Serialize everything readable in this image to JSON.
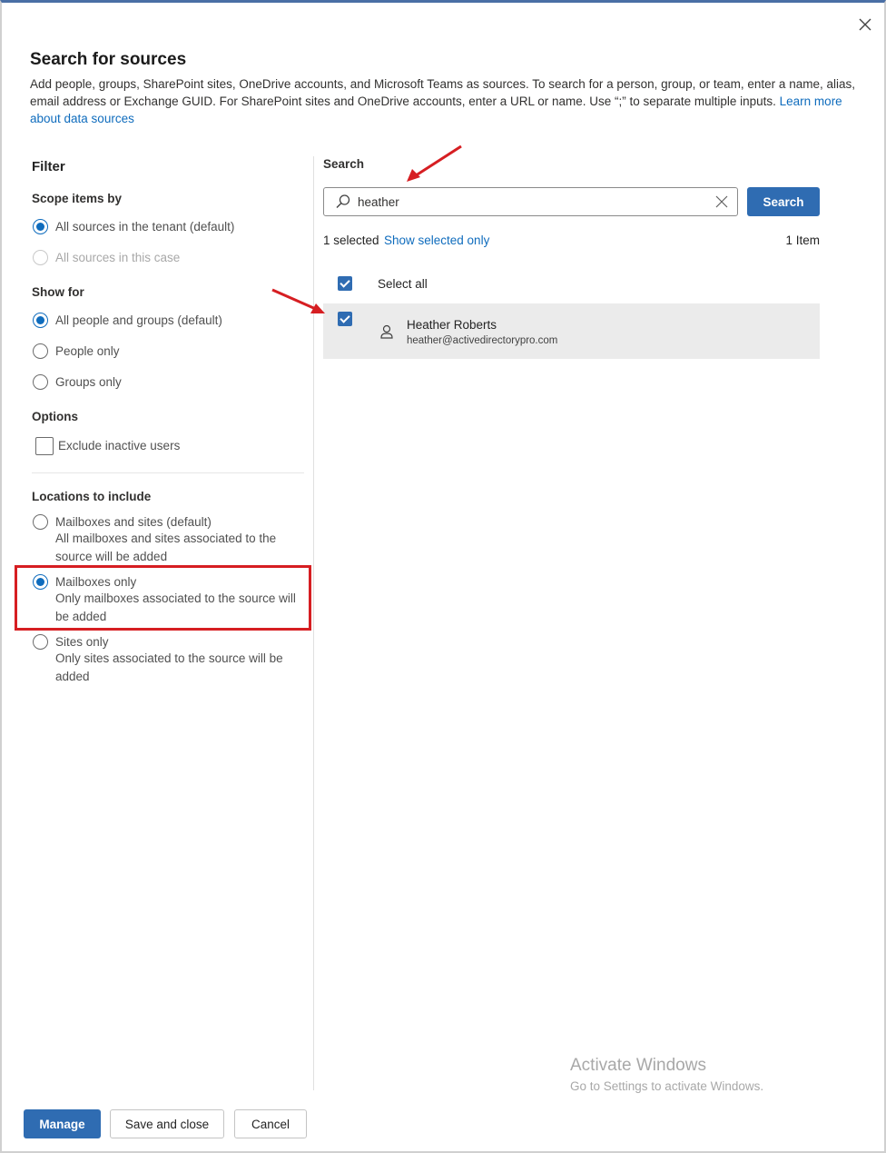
{
  "dialog": {
    "title": "Search for sources",
    "description": "Add people, groups, SharePoint sites, OneDrive accounts, and Microsoft Teams as sources. To search for a person, group, or team, enter a name, alias, email address or Exchange GUID. For SharePoint sites and OneDrive accounts, enter a URL or name. Use “;” to separate multiple inputs.",
    "learn_more": "Learn more about data sources"
  },
  "filter": {
    "title": "Filter",
    "scope": {
      "label": "Scope items by",
      "options": [
        "All sources in the tenant (default)",
        "All sources in this case"
      ]
    },
    "show_for": {
      "label": "Show for",
      "options": [
        "All people and groups (default)",
        "People only",
        "Groups only"
      ]
    },
    "options": {
      "label": "Options",
      "exclude_inactive": "Exclude inactive users"
    },
    "locations": {
      "label": "Locations to include",
      "options": [
        {
          "title": "Mailboxes and sites (default)",
          "desc": "All mailboxes and sites associated to the source will be added"
        },
        {
          "title": "Mailboxes only",
          "desc": "Only mailboxes associated to the source will be added"
        },
        {
          "title": "Sites only",
          "desc": "Only sites associated to the source will be added"
        }
      ]
    }
  },
  "search": {
    "label": "Search",
    "value": "heather",
    "button": "Search",
    "selected_count": "1 selected",
    "show_selected": "Show selected only",
    "item_count": "1 Item",
    "select_all": "Select all",
    "results": [
      {
        "name": "Heather Roberts",
        "email": "heather@activedirectorypro.com"
      }
    ]
  },
  "watermark": {
    "line1": "Activate Windows",
    "line2": "Go to Settings to activate Windows."
  },
  "footer": {
    "manage": "Manage",
    "save_close": "Save and close",
    "cancel": "Cancel"
  },
  "colors": {
    "accent": "#2f6cb2",
    "link": "#0f6cbd",
    "highlight": "#d61e22"
  }
}
